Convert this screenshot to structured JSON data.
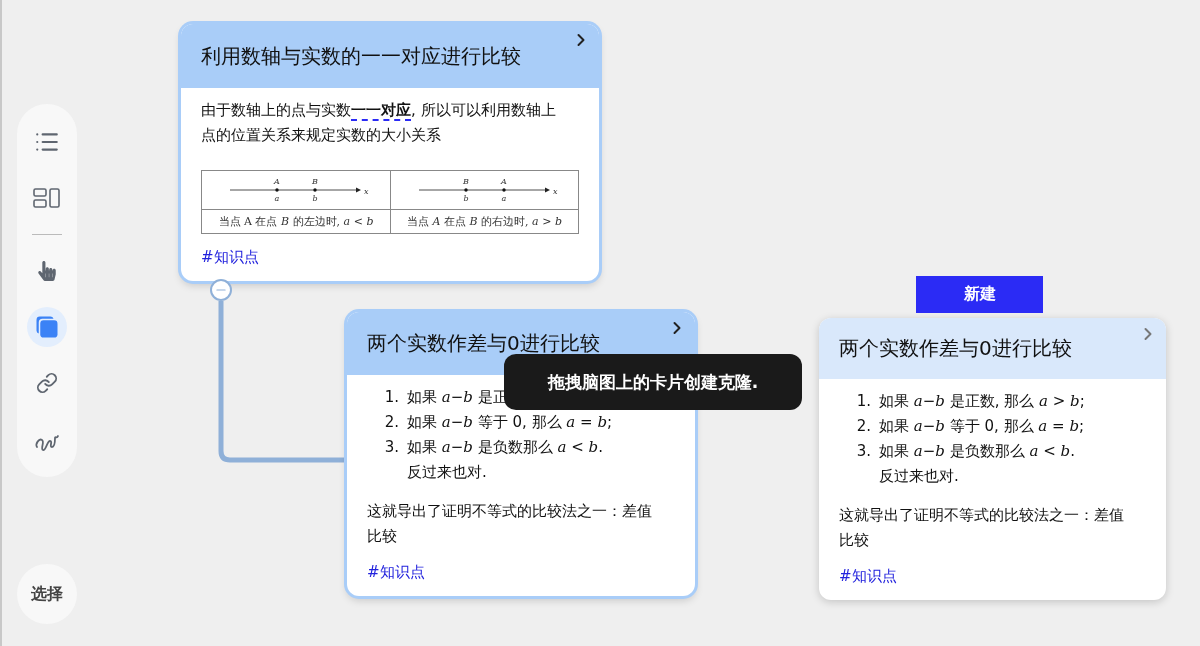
{
  "sidebar": {
    "groups": [
      [
        {
          "selected": false
        },
        {
          "selected": false
        }
      ],
      [
        {
          "selected": false
        },
        {
          "selected": true
        },
        {
          "selected": false
        },
        {
          "selected": false
        }
      ]
    ]
  },
  "select_button": {
    "label": "选择"
  },
  "cards": [
    {
      "kind": "node",
      "title": "利用数轴与实数的一一对应进行比较",
      "collapse": true,
      "blocks": [
        {
          "kind": "paragraph",
          "text": "由于数轴上的点与实数**一一对应**, 所以可以利用数轴上点的位置关系来规定实数的大小关系"
        },
        {
          "kind": "figure",
          "cells": [
            {
              "points": [
                {
                  "upper": "A",
                  "lower": "a"
                },
                {
                  "upper": "B",
                  "lower": "b"
                }
              ],
              "axis_label": "x",
              "caption": "当点 A 在点 *B* 的左边时, *a* < *b*"
            },
            {
              "points": [
                {
                  "upper": "B",
                  "lower": "b"
                },
                {
                  "upper": "A",
                  "lower": "a"
                }
              ],
              "axis_label": "x",
              "caption": "当点 *A* 在点 *B* 的右边时, *a* > *b*"
            }
          ]
        },
        {
          "kind": "tag",
          "text": "#知识点"
        }
      ]
    },
    {
      "kind": "node",
      "title": "两个实数作差与0进行比较",
      "collapse": false,
      "blocks": [
        {
          "kind": "list",
          "items": [
            {
              "number": "1.",
              "text": "如果 *a*−*b* 是正"
            },
            {
              "number": "2.",
              "text": "如果 *a*−*b* 等于 0, 那么 *a* = *b*;"
            },
            {
              "number": "3.",
              "text": "如果 *a*−*b* 是负数那么 *a* < *b*.",
              "extra": "反过来也对."
            }
          ]
        },
        {
          "kind": "paragraph",
          "text": "这就导出了证明不等式的比较法之一：差值比较"
        },
        {
          "kind": "tag",
          "text": "#知识点"
        }
      ]
    },
    {
      "kind": "clone",
      "title": "两个实数作差与0进行比较",
      "collapse": false,
      "blocks": [
        {
          "kind": "list",
          "items": [
            {
              "number": "1.",
              "text": "如果 *a*−*b* 是正数, 那么 *a* > *b*;"
            },
            {
              "number": "2.",
              "text": "如果 *a*−*b* 等于 0, 那么 *a* = *b*;"
            },
            {
              "number": "3.",
              "text": "如果 *a*−*b* 是负数那么 *a* < *b*.",
              "extra": "反过来也对."
            }
          ]
        },
        {
          "kind": "paragraph",
          "text": "这就导出了证明不等式的比较法之一：差值比较"
        },
        {
          "kind": "tag",
          "text": "#知识点"
        }
      ]
    }
  ],
  "new_button": {
    "label": "新建"
  },
  "tooltip": {
    "text": "拖拽脑图上的卡片创建克隆."
  }
}
